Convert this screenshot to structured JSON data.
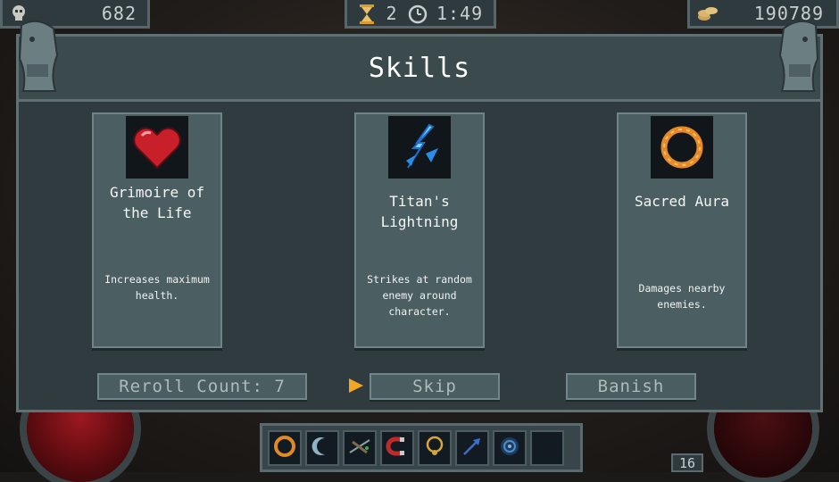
{
  "hud": {
    "kills": "682",
    "wave": "2",
    "timer": "1:49",
    "gold": "190789",
    "level": "16"
  },
  "dialog": {
    "title": "Skills"
  },
  "cards": [
    {
      "name": "Grimoire of the Life",
      "description": "Increases maximum health.",
      "icon": "heart-icon"
    },
    {
      "name": "Titan's Lightning",
      "description": "Strikes at random enemy around character.",
      "icon": "lightning-icon"
    },
    {
      "name": "Sacred Aura",
      "description": "Damages nearby enemies.",
      "icon": "aura-ring-icon"
    }
  ],
  "buttons": {
    "reroll": "Reroll Count: 7",
    "skip": "Skip",
    "banish": "Banish"
  },
  "skillbar": {
    "slots": [
      "sacred-aura-icon",
      "crescent-icon",
      "crossbow-icon",
      "magnet-icon",
      "necklace-icon",
      "arrow-icon",
      "vortex-icon",
      "empty-slot"
    ]
  },
  "colors": {
    "accent": "#f2a623",
    "panel": "#3a4a4d",
    "card": "#4b5e62"
  }
}
